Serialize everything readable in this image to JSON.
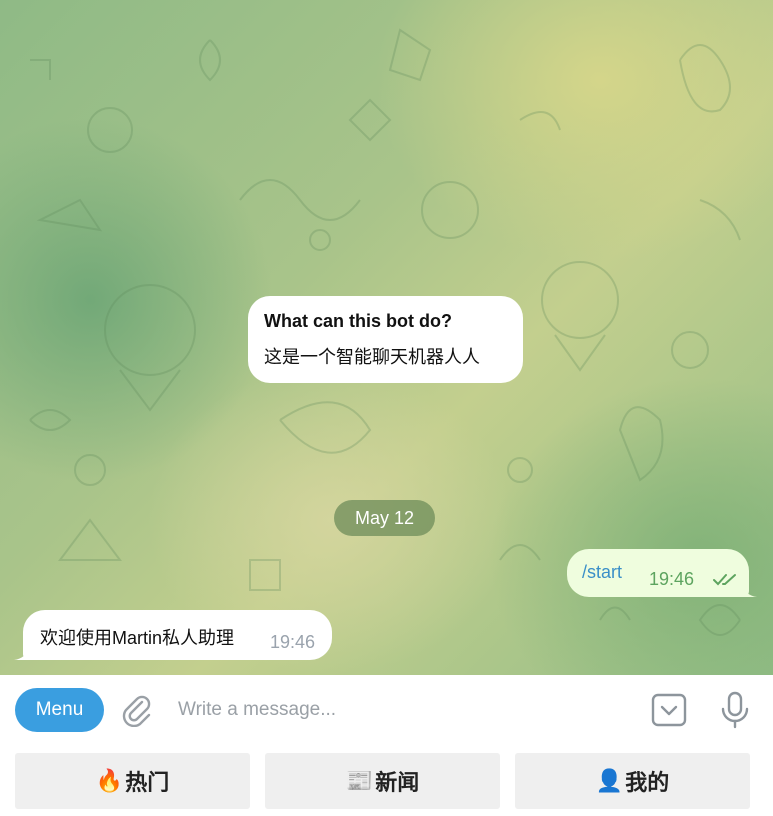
{
  "chat": {
    "bot_intro": {
      "title": "What can this bot do?",
      "description": "这是一个智能聊天机器人人"
    },
    "date_divider": "May 12",
    "messages": [
      {
        "direction": "outgoing",
        "text": "/start",
        "time": "19:46",
        "status": "read"
      },
      {
        "direction": "incoming",
        "text": "欢迎使用Martin私人助理",
        "time": "19:46"
      }
    ]
  },
  "composer": {
    "menu_label": "Menu",
    "placeholder": "Write a message...",
    "icons": [
      "paperclip-icon",
      "keyboard-toggle-icon",
      "microphone-icon"
    ]
  },
  "keyboard": {
    "buttons": [
      {
        "emoji": "🔥",
        "label": "热门"
      },
      {
        "emoji": "📰",
        "label": "新闻"
      },
      {
        "emoji": "👤",
        "label": "我的"
      }
    ]
  },
  "colors": {
    "menu_button": "#3a9ee0",
    "outgoing_bubble": "#effdde",
    "incoming_bubble": "#ffffff",
    "link_text": "#3a8fc8",
    "read_check": "#5da45f",
    "keyboard_button": "#efefef"
  }
}
